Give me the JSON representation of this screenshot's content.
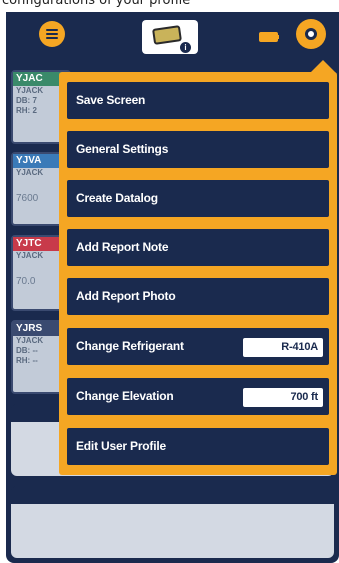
{
  "caption": "configurations of your profile",
  "background_cards": [
    {
      "header": "YJAC",
      "header_color": "#3a8a6a",
      "lines": [
        "YJACK",
        "DB: 7",
        "RH: 2"
      ],
      "big": ""
    },
    {
      "header": "YJVA",
      "header_color": "#3a7ab8",
      "lines": [
        "YJACK"
      ],
      "big": "7600"
    },
    {
      "header": "YJTC",
      "header_color": "#c83a4a",
      "lines": [
        "YJACK"
      ],
      "big": "70.0"
    },
    {
      "header": "YJRS",
      "header_color": "#3a4a70",
      "lines": [
        "YJACK",
        "DB: --",
        "RH: --"
      ],
      "big": ""
    }
  ],
  "menu": {
    "items": [
      {
        "label": "Save Screen"
      },
      {
        "label": "General Settings"
      },
      {
        "label": "Create Datalog"
      },
      {
        "label": "Add Report Note"
      },
      {
        "label": "Add Report Photo"
      },
      {
        "label": "Change Refrigerant",
        "value": "R-410A"
      },
      {
        "label": "Change Elevation",
        "value": "700 ft"
      },
      {
        "label": "Edit User Profile"
      }
    ]
  },
  "colors": {
    "navy": "#1a2a4e",
    "accent": "#f5a623",
    "card_bg": "#c2cbd8"
  },
  "icons": {
    "menu": "hamburger-menu-icon",
    "device": "device-logo-icon",
    "battery": "battery-icon",
    "settings": "settings-icon"
  }
}
